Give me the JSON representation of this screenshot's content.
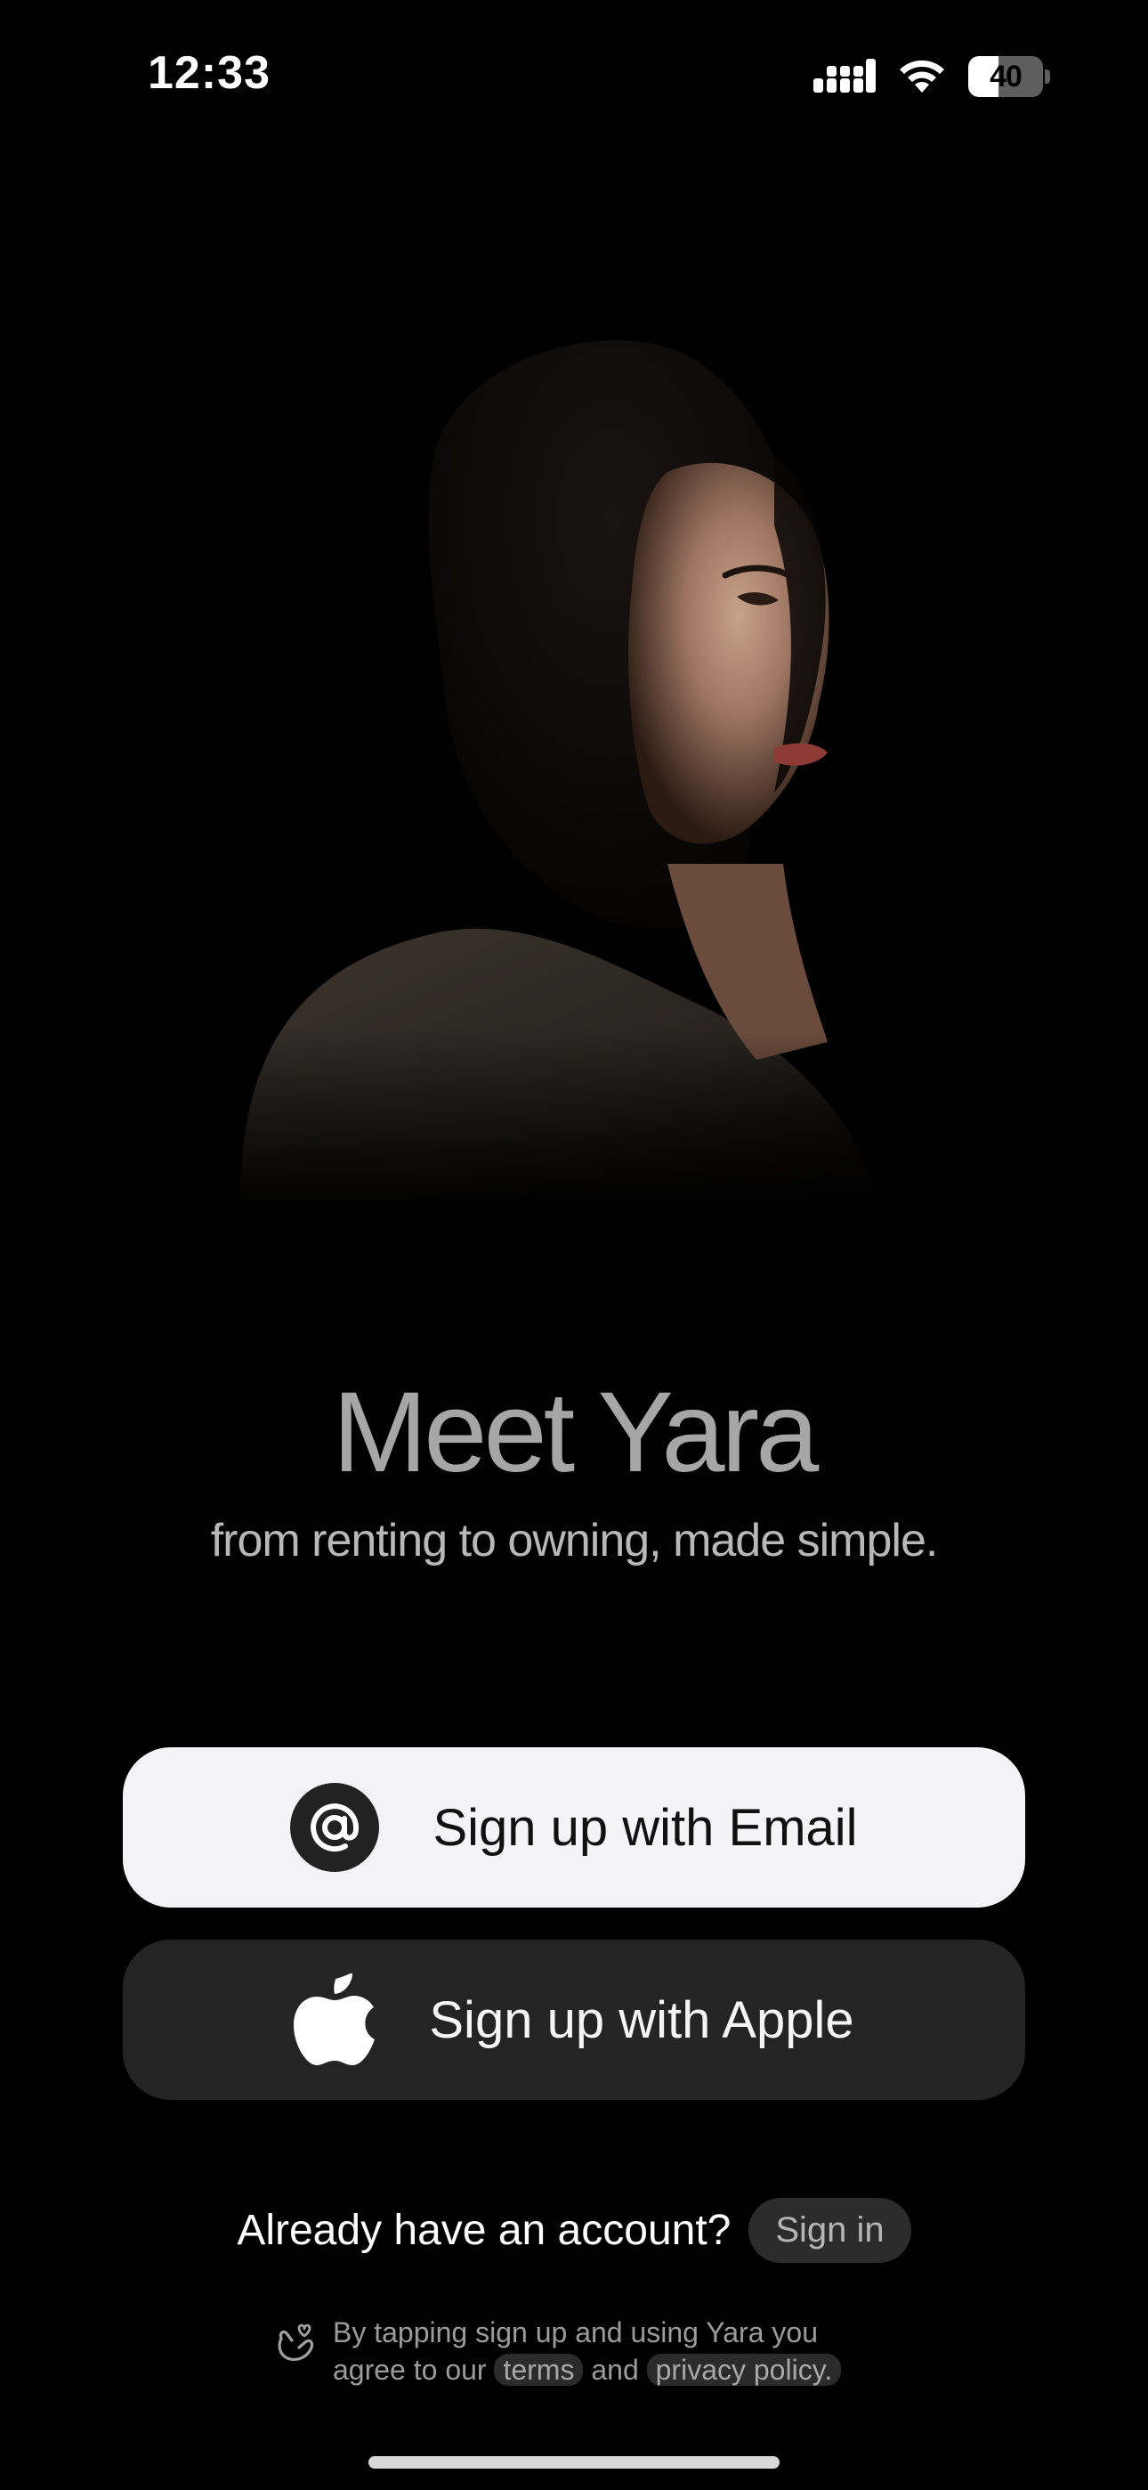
{
  "status_bar": {
    "time": "12:33",
    "battery_text": "40",
    "battery_level": 0.4,
    "icons": [
      "signal-icon",
      "wifi-icon",
      "battery-icon"
    ]
  },
  "hero": {
    "subject": "portrait-photo"
  },
  "headline": {
    "title": "Meet Yara",
    "tagline": "from renting to owning, made simple."
  },
  "buttons": {
    "email_label": "Sign up with Email",
    "email_icon": "at-icon",
    "apple_label": "Sign up with Apple",
    "apple_icon": "apple-icon"
  },
  "signin": {
    "question": "Already have an account?",
    "link_label": "Sign in"
  },
  "legal": {
    "icon": "heart-hand-icon",
    "line1": "By tapping sign up and using Yara you",
    "line2_prefix": "agree to our",
    "terms_label": "terms",
    "and_text": "and",
    "privacy_label": "privacy policy."
  },
  "colors": {
    "background": "#000000",
    "email_button_bg": "#f4f4f6",
    "apple_button_bg": "#242424",
    "headline": "#a6a6a6",
    "chip_bg": "#2b2b2b"
  }
}
